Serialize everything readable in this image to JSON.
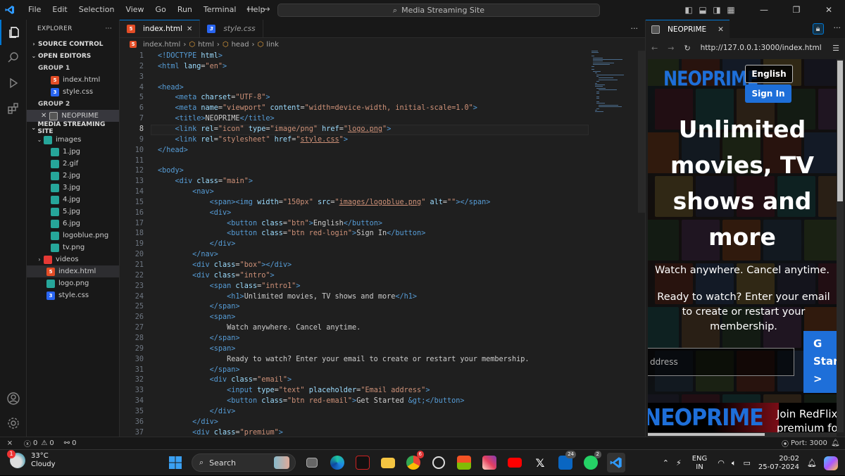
{
  "menu": [
    "File",
    "Edit",
    "Selection",
    "View",
    "Go",
    "Run",
    "Terminal",
    "Help"
  ],
  "command_center": "Media Streaming Site",
  "explorer": {
    "title": "EXPLORER",
    "source_control": "SOURCE CONTROL",
    "open_editors": "OPEN EDITORS",
    "group1": "GROUP 1",
    "group1_files": [
      "index.html",
      "style.css"
    ],
    "group2": "GROUP 2",
    "group2_item": "NEOPRIME",
    "project": "MEDIA STREAMING SITE",
    "images_folder": "images",
    "image_files": [
      "1.jpg",
      "2.gif",
      "2.jpg",
      "3.jpg",
      "4.jpg",
      "5.jpg",
      "6.jpg",
      "logoblue.png",
      "tv.png"
    ],
    "videos_folder": "videos",
    "root_files": [
      "index.html",
      "logo.png",
      "style.css"
    ]
  },
  "editor": {
    "tabs": [
      "index.html",
      "style.css"
    ],
    "breadcrumb": [
      "index.html",
      "html",
      "head",
      "link"
    ],
    "current_line": 8
  },
  "code": [
    [
      [
        "t",
        "<!DOCTYPE "
      ],
      [
        "a",
        "html"
      ],
      [
        "t",
        ">"
      ]
    ],
    [
      [
        "t",
        "<html "
      ],
      [
        "a",
        "lang"
      ],
      [
        "w",
        "="
      ],
      [
        "s",
        "\"en\""
      ],
      [
        "t",
        ">"
      ]
    ],
    [],
    [
      [
        "t",
        "<head>"
      ]
    ],
    [
      [
        "w",
        "    "
      ],
      [
        "t",
        "<meta "
      ],
      [
        "a",
        "charset"
      ],
      [
        "w",
        "="
      ],
      [
        "s",
        "\"UTF-8\""
      ],
      [
        "t",
        ">"
      ]
    ],
    [
      [
        "w",
        "    "
      ],
      [
        "t",
        "<meta "
      ],
      [
        "a",
        "name"
      ],
      [
        "w",
        "="
      ],
      [
        "s",
        "\"viewport\" "
      ],
      [
        "a",
        "content"
      ],
      [
        "w",
        "="
      ],
      [
        "s",
        "\"width=device-width, initial-scale=1.0\""
      ],
      [
        "t",
        ">"
      ]
    ],
    [
      [
        "w",
        "    "
      ],
      [
        "t",
        "<title>"
      ],
      [
        "w",
        "NEOPRIME"
      ],
      [
        "t",
        "</title>"
      ]
    ],
    [
      [
        "w",
        "    "
      ],
      [
        "t",
        "<link "
      ],
      [
        "a",
        "rel"
      ],
      [
        "w",
        "="
      ],
      [
        "s",
        "\"icon\" "
      ],
      [
        "a",
        "type"
      ],
      [
        "w",
        "="
      ],
      [
        "s",
        "\"image/png\" "
      ],
      [
        "a",
        "href"
      ],
      [
        "w",
        "="
      ],
      [
        "s",
        "\""
      ],
      [
        "u",
        "logo.png"
      ],
      [
        "s",
        "\""
      ],
      [
        "t",
        ">"
      ]
    ],
    [
      [
        "w",
        "    "
      ],
      [
        "t",
        "<link "
      ],
      [
        "a",
        "rel"
      ],
      [
        "w",
        "="
      ],
      [
        "s",
        "\"stylesheet\" "
      ],
      [
        "a",
        "href"
      ],
      [
        "w",
        "="
      ],
      [
        "s",
        "\""
      ],
      [
        "u",
        "style.css"
      ],
      [
        "s",
        "\""
      ],
      [
        "t",
        ">"
      ]
    ],
    [
      [
        "t",
        "</head>"
      ]
    ],
    [],
    [
      [
        "t",
        "<body>"
      ]
    ],
    [
      [
        "w",
        "    "
      ],
      [
        "t",
        "<div "
      ],
      [
        "a",
        "class"
      ],
      [
        "w",
        "="
      ],
      [
        "s",
        "\"main\""
      ],
      [
        "t",
        ">"
      ]
    ],
    [
      [
        "w",
        "        "
      ],
      [
        "t",
        "<nav>"
      ]
    ],
    [
      [
        "w",
        "            "
      ],
      [
        "t",
        "<span><img "
      ],
      [
        "a",
        "width"
      ],
      [
        "w",
        "="
      ],
      [
        "s",
        "\"150px\" "
      ],
      [
        "a",
        "src"
      ],
      [
        "w",
        "="
      ],
      [
        "s",
        "\""
      ],
      [
        "u",
        "images/logoblue.png"
      ],
      [
        "s",
        "\" "
      ],
      [
        "a",
        "alt"
      ],
      [
        "w",
        "="
      ],
      [
        "s",
        "\"\""
      ],
      [
        "t",
        "></span>"
      ]
    ],
    [
      [
        "w",
        "            "
      ],
      [
        "t",
        "<div>"
      ]
    ],
    [
      [
        "w",
        "                "
      ],
      [
        "t",
        "<button "
      ],
      [
        "a",
        "class"
      ],
      [
        "w",
        "="
      ],
      [
        "s",
        "\"btn\""
      ],
      [
        "t",
        ">"
      ],
      [
        "w",
        "English"
      ],
      [
        "t",
        "</button>"
      ]
    ],
    [
      [
        "w",
        "                "
      ],
      [
        "t",
        "<button "
      ],
      [
        "a",
        "class"
      ],
      [
        "w",
        "="
      ],
      [
        "s",
        "\"btn red-login\""
      ],
      [
        "t",
        ">"
      ],
      [
        "w",
        "Sign In"
      ],
      [
        "t",
        "</button>"
      ]
    ],
    [
      [
        "w",
        "            "
      ],
      [
        "t",
        "</div>"
      ]
    ],
    [
      [
        "w",
        "        "
      ],
      [
        "t",
        "</nav>"
      ]
    ],
    [
      [
        "w",
        "        "
      ],
      [
        "t",
        "<div "
      ],
      [
        "a",
        "class"
      ],
      [
        "w",
        "="
      ],
      [
        "s",
        "\"box\""
      ],
      [
        "t",
        "></div>"
      ]
    ],
    [
      [
        "w",
        "        "
      ],
      [
        "t",
        "<div "
      ],
      [
        "a",
        "class"
      ],
      [
        "w",
        "="
      ],
      [
        "s",
        "\"intro\""
      ],
      [
        "t",
        ">"
      ]
    ],
    [
      [
        "w",
        "            "
      ],
      [
        "t",
        "<span "
      ],
      [
        "a",
        "class"
      ],
      [
        "w",
        "="
      ],
      [
        "s",
        "\"intro1\""
      ],
      [
        "t",
        ">"
      ]
    ],
    [
      [
        "w",
        "                "
      ],
      [
        "t",
        "<h1>"
      ],
      [
        "w",
        "Unlimited movies, TV shows and more"
      ],
      [
        "t",
        "</h1>"
      ]
    ],
    [
      [
        "w",
        "            "
      ],
      [
        "t",
        "</span>"
      ]
    ],
    [
      [
        "w",
        "            "
      ],
      [
        "t",
        "<span>"
      ]
    ],
    [
      [
        "w",
        "                Watch anywhere. Cancel anytime."
      ]
    ],
    [
      [
        "w",
        "            "
      ],
      [
        "t",
        "</span>"
      ]
    ],
    [
      [
        "w",
        "            "
      ],
      [
        "t",
        "<span>"
      ]
    ],
    [
      [
        "w",
        "                Ready to watch? Enter your email to create or restart your membership."
      ]
    ],
    [
      [
        "w",
        "            "
      ],
      [
        "t",
        "</span>"
      ]
    ],
    [
      [
        "w",
        "            "
      ],
      [
        "t",
        "<div "
      ],
      [
        "a",
        "class"
      ],
      [
        "w",
        "="
      ],
      [
        "s",
        "\"email\""
      ],
      [
        "t",
        ">"
      ]
    ],
    [
      [
        "w",
        "                "
      ],
      [
        "t",
        "<input "
      ],
      [
        "a",
        "type"
      ],
      [
        "w",
        "="
      ],
      [
        "s",
        "\"text\" "
      ],
      [
        "a",
        "placeholder"
      ],
      [
        "w",
        "="
      ],
      [
        "s",
        "\"Email address\""
      ],
      [
        "t",
        ">"
      ]
    ],
    [
      [
        "w",
        "                "
      ],
      [
        "t",
        "<button "
      ],
      [
        "a",
        "class"
      ],
      [
        "w",
        "="
      ],
      [
        "s",
        "\"btn red-email\""
      ],
      [
        "t",
        ">"
      ],
      [
        "w",
        "Get Started "
      ],
      [
        "e",
        "&gt;"
      ],
      [
        "t",
        "</button>"
      ]
    ],
    [
      [
        "w",
        "            "
      ],
      [
        "t",
        "</div>"
      ]
    ],
    [
      [
        "w",
        "        "
      ],
      [
        "t",
        "</div>"
      ]
    ],
    [
      [
        "w",
        "        "
      ],
      [
        "t",
        "<div "
      ],
      [
        "a",
        "class"
      ],
      [
        "w",
        "="
      ],
      [
        "s",
        "\"premium\""
      ],
      [
        "t",
        ">"
      ]
    ]
  ],
  "preview": {
    "tab_title": "NEOPRIME",
    "url": "http://127.0.0.1:3000/index.html",
    "logo": "NEOPRIME",
    "btn_english": "English",
    "btn_signin": "Sign In",
    "headline": "Unlimited movies, TV shows and more",
    "tagline": "Watch anywhere. Cancel anytime.",
    "cta_text": "Ready to watch? Enter your email to create or restart your membership.",
    "email_placeholder": "ddress",
    "get_started": "G\nStar\n>",
    "banner_logo": "NEOPRIME",
    "banner_text": "Join RedFlix\npremium fo"
  },
  "status": {
    "errors": "0",
    "warnings": "0",
    "ports": "0",
    "port": "Port: 3000"
  },
  "taskbar": {
    "temp": "33°C",
    "weather": "Cloudy",
    "weather_badge": "1",
    "search": "Search",
    "lang1": "ENG",
    "lang2": "IN",
    "time": "20:02",
    "date": "25-07-2024",
    "badges": {
      "chrome": "6",
      "linkedin": "24",
      "whatsapp": "2"
    }
  },
  "colors": {
    "accent": "#0078d4",
    "brand": "#1e6fd9"
  }
}
